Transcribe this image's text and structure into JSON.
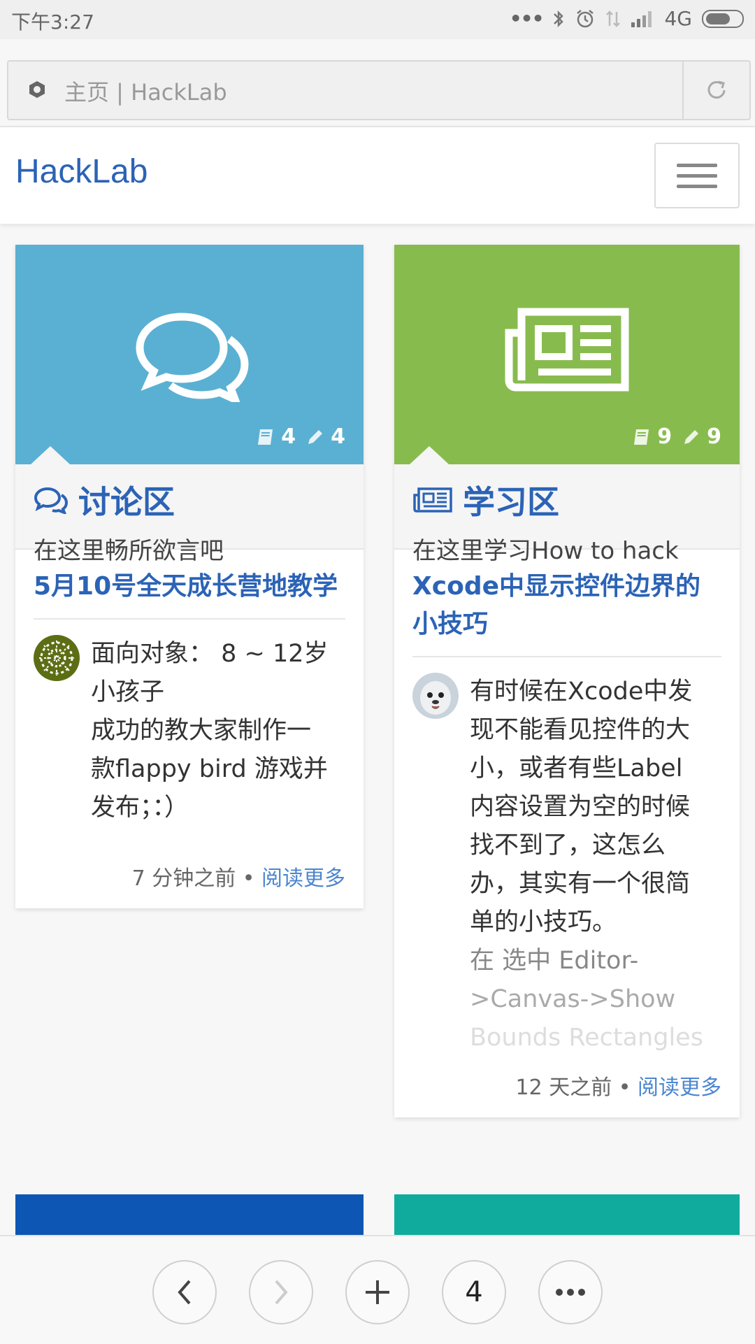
{
  "status_bar": {
    "time": "下午3:27",
    "network": "4G",
    "icons": [
      "more-dots-icon",
      "bluetooth-icon",
      "alarm-icon",
      "data-arrows-icon",
      "signal-icon",
      "battery-icon"
    ]
  },
  "address_bar": {
    "title": "主页 | HackLab",
    "favicon": "hexagon-icon",
    "reload_icon": "reload-icon"
  },
  "navbar": {
    "brand": "HackLab",
    "menu_icon": "hamburger-icon"
  },
  "cards": [
    {
      "hero_color": "#5ab0d2",
      "hero_icon": "chat-bubbles-icon",
      "topics": "4",
      "posts": "4",
      "category": "讨论区",
      "description": "在这里畅所欲言吧",
      "post_title": "5月10号全天成长营地教学",
      "excerpt_lines": [
        "面向对象： 8 ~ 12岁",
        "小孩子",
        "成功的教大家制作一",
        "款flappy bird 游戏并",
        "发布；：）"
      ],
      "time": "7 分钟之前",
      "separator": "•",
      "read_more": "阅读更多"
    },
    {
      "hero_color": "#88bb4e",
      "hero_icon": "newspaper-icon",
      "topics": "9",
      "posts": "9",
      "category": "学习区",
      "description": "在这里学习How to hack",
      "post_title": "Xcode中显示控件边界的小技巧",
      "excerpt_lines": [
        "有时候在Xcode中发",
        "现不能看见控件的大",
        "小，或者有些Label",
        "内容设置为空的时候",
        "找不到了，这怎么",
        "办，其实有一个很简",
        "单的小技巧。"
      ],
      "excerpt_faded_lines": [
        "在 选中 Editor-",
        ">Canvas->Show",
        "Bounds Rectangles"
      ],
      "time": "12 天之前",
      "separator": "•",
      "read_more": "阅读更多"
    }
  ],
  "peek_colors": [
    "#0e56b4",
    "#10ab9d"
  ],
  "toolbar": {
    "back_icon": "chevron-left-icon",
    "forward_icon": "chevron-right-icon",
    "new_tab_icon": "plus-icon",
    "tab_count": "4",
    "menu_icon": "more-dots-icon"
  }
}
